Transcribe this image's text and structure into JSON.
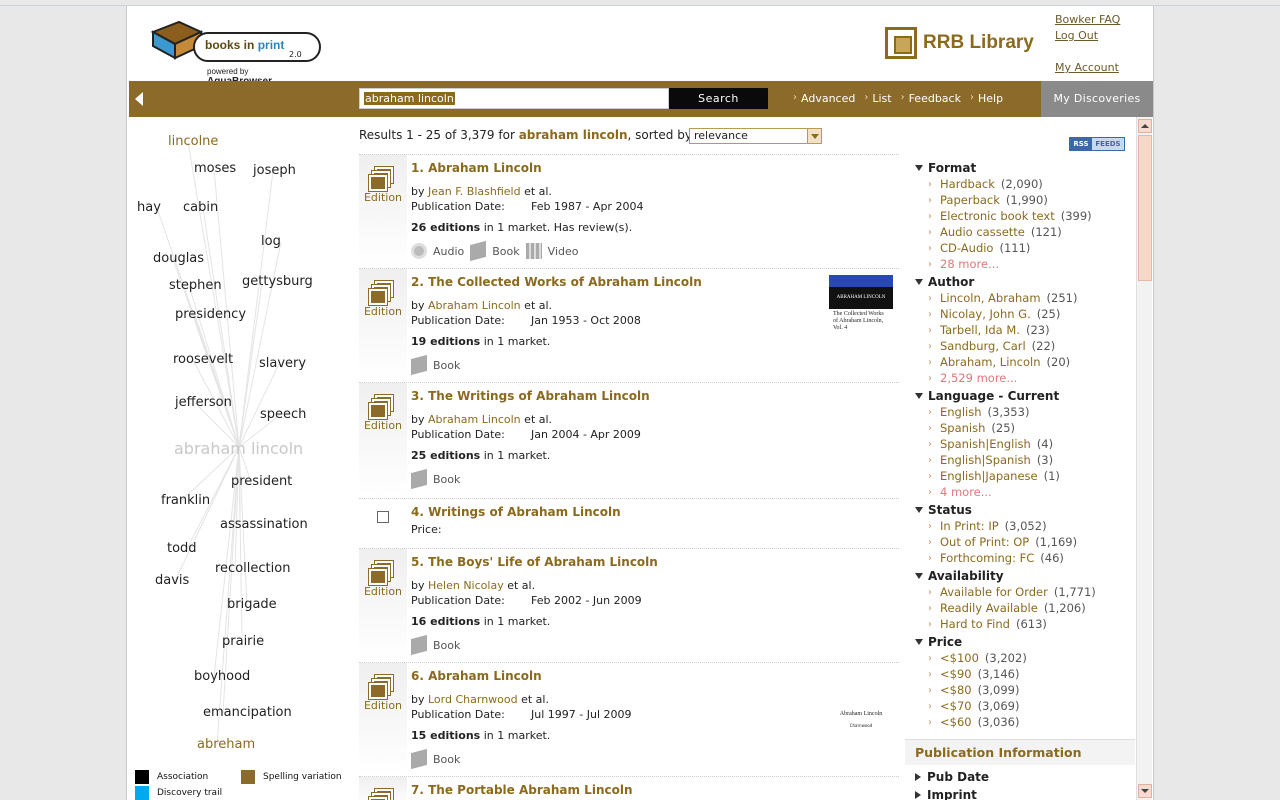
{
  "header": {
    "logo": {
      "brand_text": "books in",
      "brand_accent": "print",
      "version": "2.0",
      "powered_by": "powered by",
      "powered_brand": "AquaBrowser"
    },
    "library_name": "RRB Library",
    "links": {
      "faq": "Bowker FAQ",
      "logout": "Log Out",
      "account": "My Account"
    }
  },
  "nav": {
    "search_value": "abraham lincoln",
    "search_button": "Search",
    "links": [
      "Advanced",
      "List",
      "Feedback",
      "Help"
    ],
    "my_discoveries": "My Discoveries"
  },
  "cloud": {
    "words": [
      {
        "text": "lincolne",
        "type": "spell"
      },
      {
        "text": "moses",
        "type": "assoc"
      },
      {
        "text": "joseph",
        "type": "assoc"
      },
      {
        "text": "hay",
        "type": "assoc"
      },
      {
        "text": "cabin",
        "type": "assoc"
      },
      {
        "text": "log",
        "type": "assoc"
      },
      {
        "text": "douglas",
        "type": "assoc"
      },
      {
        "text": "stephen",
        "type": "assoc"
      },
      {
        "text": "gettysburg",
        "type": "assoc"
      },
      {
        "text": "presidency",
        "type": "assoc"
      },
      {
        "text": "roosevelt",
        "type": "assoc"
      },
      {
        "text": "slavery",
        "type": "assoc"
      },
      {
        "text": "jefferson",
        "type": "assoc"
      },
      {
        "text": "speech",
        "type": "assoc"
      },
      {
        "text": "abraham lincoln",
        "type": "center"
      },
      {
        "text": "president",
        "type": "assoc"
      },
      {
        "text": "franklin",
        "type": "assoc"
      },
      {
        "text": "assassination",
        "type": "assoc"
      },
      {
        "text": "todd",
        "type": "assoc"
      },
      {
        "text": "recollection",
        "type": "assoc"
      },
      {
        "text": "davis",
        "type": "assoc"
      },
      {
        "text": "brigade",
        "type": "assoc"
      },
      {
        "text": "prairie",
        "type": "assoc"
      },
      {
        "text": "boyhood",
        "type": "assoc"
      },
      {
        "text": "emancipation",
        "type": "assoc"
      },
      {
        "text": "abreham",
        "type": "spell"
      }
    ],
    "legend": [
      {
        "label": "Association",
        "color": "#000000"
      },
      {
        "label": "Spelling variation",
        "color": "#8b6a2a"
      },
      {
        "label": "Discovery trail",
        "color": "#00aaee"
      }
    ]
  },
  "results": {
    "summary_prefix": "Results 1 - 25 of 3,379 for",
    "query": "abraham lincoln",
    "sorted_label": ", sorted by:",
    "sort_value": "relevance",
    "items": [
      {
        "number": "1.",
        "title": "Abraham Lincoln",
        "by_label": "by",
        "author": "Jean F. Blashfield",
        "etal": "et al.",
        "pub_label": "Publication Date:",
        "pub_range": "Feb 1987 - Apr 2004",
        "editions": "26 editions",
        "market": "in 1 market. Has review(s).",
        "kind": "Edition",
        "formats": [
          "Audio",
          "Book",
          "Video"
        ]
      },
      {
        "number": "2.",
        "title": "The Collected Works of Abraham Lincoln",
        "by_label": "by",
        "author": "Abraham Lincoln",
        "etal": "et al.",
        "pub_label": "Publication Date:",
        "pub_range": "Jan 1953 - Oct 2008",
        "editions": "19 editions",
        "market": "in 1 market.",
        "kind": "Edition",
        "formats": [
          "Book"
        ],
        "cover_title": "ABRAHAM LINCOLN",
        "cover_sub": "The Collected Works of Abraham Lincoln, Vol. 4"
      },
      {
        "number": "3.",
        "title": "The Writings of Abraham Lincoln",
        "by_label": "by",
        "author": "Abraham Lincoln",
        "etal": "et al.",
        "pub_label": "Publication Date:",
        "pub_range": "Jan 2004 - Apr 2009",
        "editions": "25 editions",
        "market": "in 1 market.",
        "kind": "Edition",
        "formats": [
          "Book"
        ]
      },
      {
        "number": "4.",
        "title": "Writings of Abraham Lincoln",
        "price_label": "Price:"
      },
      {
        "number": "5.",
        "title": "The Boys' Life of Abraham Lincoln",
        "by_label": "by",
        "author": "Helen Nicolay",
        "etal": "et al.",
        "pub_label": "Publication Date:",
        "pub_range": "Feb 2002 - Jun 2009",
        "editions": "16 editions",
        "market": "in 1 market.",
        "kind": "Edition",
        "formats": [
          "Book"
        ]
      },
      {
        "number": "6.",
        "title": "Abraham Lincoln",
        "by_label": "by",
        "author": "Lord Charnwood",
        "etal": "et al.",
        "pub_label": "Publication Date:",
        "pub_range": "Jul 1997 - Jul 2009",
        "editions": "15 editions",
        "market": "in 1 market.",
        "kind": "Edition",
        "formats": [
          "Book"
        ],
        "cover_title": "Abraham Lincoln",
        "cover_sub": "Charnwood"
      },
      {
        "number": "7.",
        "title": "The Portable Abraham Lincoln"
      }
    ]
  },
  "rss": {
    "left": "RSS",
    "right": "FEEDS"
  },
  "facets": [
    {
      "title": "Format",
      "items": [
        {
          "name": "Hardback",
          "count": "(2,090)"
        },
        {
          "name": "Paperback",
          "count": "(1,990)"
        },
        {
          "name": "Electronic book text",
          "count": "(399)"
        },
        {
          "name": "Audio cassette",
          "count": "(121)"
        },
        {
          "name": "CD-Audio",
          "count": "(111)"
        },
        {
          "name": "28 more...",
          "count": "",
          "more": true
        }
      ]
    },
    {
      "title": "Author",
      "items": [
        {
          "name": "Lincoln, Abraham",
          "count": "(251)"
        },
        {
          "name": "Nicolay, John G.",
          "count": "(25)"
        },
        {
          "name": "Tarbell, Ida M.",
          "count": "(23)"
        },
        {
          "name": "Sandburg, Carl",
          "count": "(22)"
        },
        {
          "name": "Abraham, Lincoln",
          "count": "(20)"
        },
        {
          "name": "2,529 more...",
          "count": "",
          "more": true
        }
      ]
    },
    {
      "title": "Language - Current",
      "items": [
        {
          "name": "English",
          "count": "(3,353)"
        },
        {
          "name": "Spanish",
          "count": "(25)"
        },
        {
          "name": "Spanish|English",
          "count": "(4)"
        },
        {
          "name": "English|Spanish",
          "count": "(3)"
        },
        {
          "name": "English|Japanese",
          "count": "(1)"
        },
        {
          "name": "4 more...",
          "count": "",
          "more": true
        }
      ]
    },
    {
      "title": "Status",
      "items": [
        {
          "name": "In Print: IP",
          "count": "(3,052)"
        },
        {
          "name": "Out of Print: OP",
          "count": "(1,169)"
        },
        {
          "name": "Forthcoming: FC",
          "count": "(46)"
        }
      ]
    },
    {
      "title": "Availability",
      "items": [
        {
          "name": "Available for Order",
          "count": "(1,771)"
        },
        {
          "name": "Readily Available",
          "count": "(1,206)"
        },
        {
          "name": "Hard to Find",
          "count": "(613)"
        }
      ]
    },
    {
      "title": "Price",
      "items": [
        {
          "name": "<$100",
          "count": "(3,202)"
        },
        {
          "name": "<$90",
          "count": "(3,146)"
        },
        {
          "name": "<$80",
          "count": "(3,099)"
        },
        {
          "name": "<$70",
          "count": "(3,069)"
        },
        {
          "name": "<$60",
          "count": "(3,036)"
        }
      ]
    }
  ],
  "pub_info": {
    "title": "Publication Information",
    "items": [
      "Pub Date",
      "Imprint"
    ]
  }
}
